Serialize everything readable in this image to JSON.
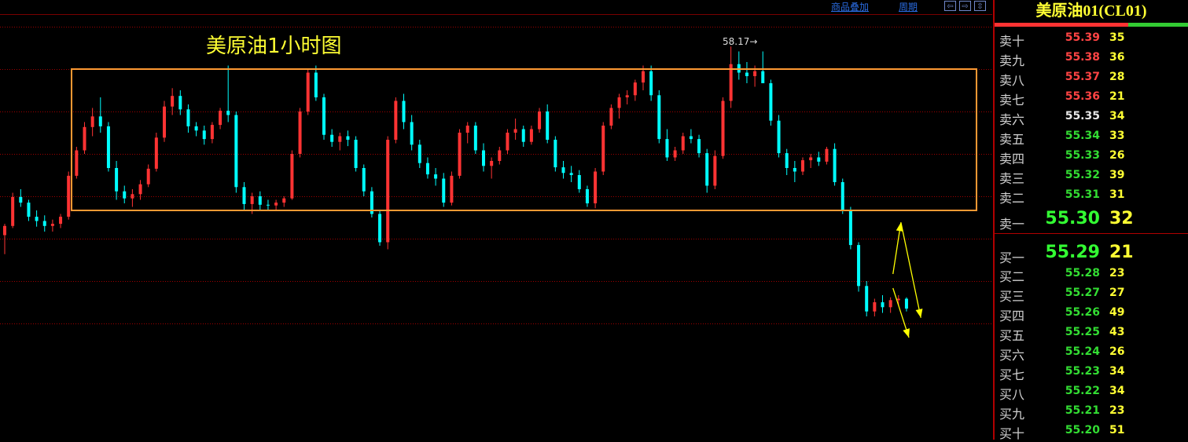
{
  "toolbar": {
    "overlay_label": "商品叠加",
    "period_label": "周期"
  },
  "chart_title": "美原油1小时图",
  "peak_label": "58.17→",
  "chart_data": {
    "type": "candlestick",
    "title": "美原油1小时图",
    "annotation": "58.17→",
    "colors": {
      "up": "#ff3333",
      "down": "#00ffff",
      "range_box": "#ff9933",
      "arrow": "#ffff00",
      "grid": "#a00000"
    },
    "range_box": {
      "low": 55.85,
      "high": 57.85
    },
    "peak": 58.17,
    "candles": [
      [
        55.5,
        55.66,
        55.23,
        55.63
      ],
      [
        55.63,
        56.1,
        55.6,
        56.04
      ],
      [
        56.04,
        56.15,
        55.9,
        55.96
      ],
      [
        55.96,
        56.0,
        55.7,
        55.76
      ],
      [
        55.76,
        55.85,
        55.62,
        55.7
      ],
      [
        55.7,
        55.78,
        55.55,
        55.63
      ],
      [
        55.63,
        55.72,
        55.55,
        55.66
      ],
      [
        55.66,
        55.8,
        55.6,
        55.76
      ],
      [
        55.76,
        56.4,
        55.72,
        56.34
      ],
      [
        56.34,
        56.75,
        56.3,
        56.7
      ],
      [
        56.7,
        57.1,
        56.65,
        57.03
      ],
      [
        57.03,
        57.3,
        56.9,
        57.18
      ],
      [
        57.18,
        57.45,
        56.95,
        57.04
      ],
      [
        57.04,
        57.1,
        56.4,
        56.45
      ],
      [
        56.45,
        56.55,
        56.0,
        56.12
      ],
      [
        56.12,
        56.2,
        55.95,
        56.02
      ],
      [
        56.02,
        56.15,
        55.9,
        56.08
      ],
      [
        56.08,
        56.28,
        56.0,
        56.22
      ],
      [
        56.22,
        56.5,
        56.18,
        56.44
      ],
      [
        56.44,
        56.95,
        56.4,
        56.88
      ],
      [
        56.88,
        57.4,
        56.82,
        57.32
      ],
      [
        57.32,
        57.58,
        57.2,
        57.47
      ],
      [
        57.47,
        57.55,
        57.2,
        57.28
      ],
      [
        57.28,
        57.35,
        56.95,
        57.04
      ],
      [
        57.04,
        57.1,
        56.9,
        56.98
      ],
      [
        56.98,
        57.05,
        56.78,
        56.86
      ],
      [
        56.86,
        57.1,
        56.8,
        57.06
      ],
      [
        57.06,
        57.3,
        57.0,
        57.26
      ],
      [
        57.26,
        57.9,
        57.1,
        57.2
      ],
      [
        57.2,
        57.25,
        56.1,
        56.18
      ],
      [
        56.18,
        56.25,
        55.85,
        55.94
      ],
      [
        55.94,
        56.1,
        55.8,
        56.05
      ],
      [
        56.05,
        56.12,
        55.85,
        55.93
      ],
      [
        55.93,
        56.0,
        55.85,
        55.92
      ],
      [
        55.92,
        56.0,
        55.86,
        55.96
      ],
      [
        55.96,
        56.05,
        55.9,
        56.02
      ],
      [
        56.02,
        56.7,
        56.0,
        56.65
      ],
      [
        56.65,
        57.3,
        56.6,
        57.25
      ],
      [
        57.25,
        57.85,
        57.2,
        57.8
      ],
      [
        57.8,
        57.9,
        57.4,
        57.45
      ],
      [
        57.45,
        57.5,
        56.85,
        56.92
      ],
      [
        56.92,
        57.0,
        56.75,
        56.82
      ],
      [
        56.82,
        56.95,
        56.7,
        56.9
      ],
      [
        56.9,
        56.98,
        56.76,
        56.85
      ],
      [
        56.85,
        56.9,
        56.4,
        56.45
      ],
      [
        56.45,
        56.5,
        56.05,
        56.12
      ],
      [
        56.12,
        56.18,
        55.75,
        55.8
      ],
      [
        55.8,
        55.85,
        55.35,
        55.4
      ],
      [
        55.4,
        56.9,
        55.3,
        56.85
      ],
      [
        56.85,
        57.45,
        56.8,
        57.4
      ],
      [
        57.4,
        57.5,
        57.0,
        57.1
      ],
      [
        57.1,
        57.2,
        56.7,
        56.78
      ],
      [
        56.78,
        56.85,
        56.45,
        56.52
      ],
      [
        56.52,
        56.6,
        56.3,
        56.36
      ],
      [
        56.36,
        56.45,
        56.2,
        56.3
      ],
      [
        56.3,
        56.38,
        55.9,
        55.96
      ],
      [
        55.96,
        56.4,
        55.92,
        56.34
      ],
      [
        56.34,
        57.0,
        56.3,
        56.95
      ],
      [
        56.95,
        57.1,
        56.8,
        57.05
      ],
      [
        57.05,
        57.1,
        56.65,
        56.7
      ],
      [
        56.7,
        56.8,
        56.4,
        56.48
      ],
      [
        56.48,
        56.6,
        56.3,
        56.55
      ],
      [
        56.55,
        56.75,
        56.5,
        56.7
      ],
      [
        56.7,
        57.0,
        56.65,
        56.95
      ],
      [
        56.95,
        57.15,
        56.85,
        57.0
      ],
      [
        57.0,
        57.05,
        56.75,
        56.82
      ],
      [
        56.82,
        57.05,
        56.78,
        57.0
      ],
      [
        57.0,
        57.3,
        56.95,
        57.25
      ],
      [
        57.25,
        57.35,
        56.8,
        56.85
      ],
      [
        56.85,
        56.9,
        56.4,
        56.46
      ],
      [
        56.46,
        56.55,
        56.3,
        56.38
      ],
      [
        56.38,
        56.48,
        56.25,
        56.35
      ],
      [
        56.35,
        56.42,
        56.1,
        56.15
      ],
      [
        56.15,
        56.2,
        55.9,
        55.95
      ],
      [
        55.95,
        56.45,
        55.88,
        56.4
      ],
      [
        56.4,
        57.1,
        56.35,
        57.05
      ],
      [
        57.05,
        57.35,
        57.0,
        57.3
      ],
      [
        57.3,
        57.5,
        57.15,
        57.45
      ],
      [
        57.45,
        57.55,
        57.35,
        57.48
      ],
      [
        57.48,
        57.7,
        57.4,
        57.66
      ],
      [
        57.66,
        57.9,
        57.55,
        57.82
      ],
      [
        57.82,
        57.9,
        57.4,
        57.48
      ],
      [
        57.48,
        57.55,
        56.8,
        56.86
      ],
      [
        56.86,
        57.0,
        56.55,
        56.6
      ],
      [
        56.6,
        56.75,
        56.55,
        56.7
      ],
      [
        56.7,
        56.95,
        56.65,
        56.9
      ],
      [
        56.9,
        57.0,
        56.8,
        56.86
      ],
      [
        56.86,
        56.92,
        56.6,
        56.66
      ],
      [
        56.66,
        56.72,
        56.1,
        56.2
      ],
      [
        56.2,
        56.7,
        56.15,
        56.62
      ],
      [
        56.62,
        57.45,
        56.58,
        57.4
      ],
      [
        57.4,
        58.17,
        57.3,
        57.92
      ],
      [
        57.92,
        58.1,
        57.7,
        57.8
      ],
      [
        57.8,
        57.95,
        57.65,
        57.75
      ],
      [
        57.75,
        57.9,
        57.6,
        57.82
      ],
      [
        57.82,
        58.1,
        57.7,
        57.65
      ],
      [
        57.65,
        57.7,
        57.05,
        57.12
      ],
      [
        57.12,
        57.2,
        56.6,
        56.66
      ],
      [
        56.66,
        56.72,
        56.35,
        56.45
      ],
      [
        56.45,
        56.55,
        56.25,
        56.4
      ],
      [
        56.4,
        56.6,
        56.35,
        56.56
      ],
      [
        56.56,
        56.65,
        56.45,
        56.6
      ],
      [
        56.6,
        56.68,
        56.48,
        56.54
      ],
      [
        56.54,
        56.75,
        56.5,
        56.72
      ],
      [
        56.72,
        56.8,
        56.2,
        56.25
      ],
      [
        56.25,
        56.3,
        55.8,
        55.86
      ],
      [
        55.86,
        55.9,
        55.3,
        55.36
      ],
      [
        55.36,
        55.4,
        54.7,
        54.78
      ],
      [
        54.78,
        54.85,
        54.35,
        54.42
      ],
      [
        54.42,
        54.6,
        54.35,
        54.55
      ],
      [
        54.55,
        54.65,
        54.4,
        54.48
      ],
      [
        54.48,
        54.62,
        54.4,
        54.58
      ],
      [
        54.58,
        54.65,
        54.5,
        54.6
      ],
      [
        54.6,
        54.62,
        54.42,
        54.46
      ]
    ],
    "arrows": [
      {
        "from": [
          111.5,
          54.95
        ],
        "to": [
          112.5,
          55.68
        ]
      },
      {
        "from": [
          112.5,
          55.68
        ],
        "to": [
          115.0,
          54.33
        ]
      },
      {
        "from": [
          111.5,
          54.75
        ],
        "to": [
          113.5,
          54.05
        ]
      }
    ]
  },
  "quote_panel": {
    "title": "美原油01(CL01)",
    "asks": [
      {
        "label": "卖十",
        "price": "55.39",
        "vol": "35",
        "color": "#ff4444"
      },
      {
        "label": "卖九",
        "price": "55.38",
        "vol": "36",
        "color": "#ff4444"
      },
      {
        "label": "卖八",
        "price": "55.37",
        "vol": "28",
        "color": "#ff4444"
      },
      {
        "label": "卖七",
        "price": "55.36",
        "vol": "21",
        "color": "#ff4444"
      },
      {
        "label": "卖六",
        "price": "55.35",
        "vol": "34",
        "color": "#e8e8e8"
      },
      {
        "label": "卖五",
        "price": "55.34",
        "vol": "33",
        "color": "#33dd33"
      },
      {
        "label": "卖四",
        "price": "55.33",
        "vol": "26",
        "color": "#33dd33"
      },
      {
        "label": "卖三",
        "price": "55.32",
        "vol": "39",
        "color": "#33dd33"
      },
      {
        "label": "卖二",
        "price": "55.31",
        "vol": "31",
        "color": "#33dd33"
      }
    ],
    "ask1": {
      "label": "卖一",
      "price": "55.30",
      "vol": "32",
      "color": "#33ff33"
    },
    "bid1": {
      "label": "买一",
      "price": "55.29",
      "vol": "21",
      "color": "#33ff33"
    },
    "bids": [
      {
        "label": "买二",
        "price": "55.28",
        "vol": "23",
        "color": "#33dd33"
      },
      {
        "label": "买三",
        "price": "55.27",
        "vol": "27",
        "color": "#33dd33"
      },
      {
        "label": "买四",
        "price": "55.26",
        "vol": "49",
        "color": "#33dd33"
      },
      {
        "label": "买五",
        "price": "55.25",
        "vol": "43",
        "color": "#33dd33"
      },
      {
        "label": "买六",
        "price": "55.24",
        "vol": "26",
        "color": "#33dd33"
      },
      {
        "label": "买七",
        "price": "55.23",
        "vol": "34",
        "color": "#33dd33"
      },
      {
        "label": "买八",
        "price": "55.22",
        "vol": "34",
        "color": "#33dd33"
      },
      {
        "label": "买九",
        "price": "55.21",
        "vol": "23",
        "color": "#33dd33"
      },
      {
        "label": "买十",
        "price": "55.20",
        "vol": "51",
        "color": "#33dd33"
      }
    ]
  }
}
